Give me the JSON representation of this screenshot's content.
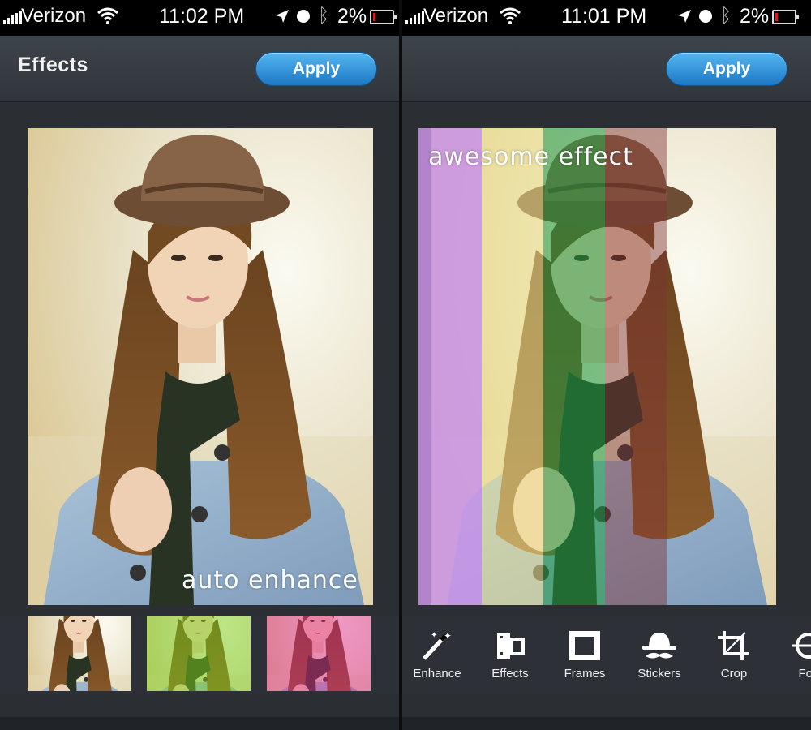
{
  "left_screen": {
    "status": {
      "carrier": "Verizon",
      "time": "11:02 PM",
      "battery": "2%"
    },
    "header": {
      "title": "Effects",
      "apply_label": "Apply"
    },
    "photo_caption": "auto enhance",
    "thumbnails": [
      {
        "name": "original",
        "tint": "none"
      },
      {
        "name": "green",
        "tint": "#7bd21c"
      },
      {
        "name": "magenta",
        "tint": "#e0208c"
      }
    ]
  },
  "right_screen": {
    "status": {
      "carrier": "Verizon",
      "time": "11:01 PM",
      "battery": "2%"
    },
    "header": {
      "apply_label": "Apply"
    },
    "photo_caption": "awesome effect",
    "stripe_colors": [
      "#c993e8",
      "#f1e58f",
      "#1c9b3f",
      "#7e3032"
    ],
    "toolbar": [
      {
        "label": "Enhance",
        "icon": "magic-wand-icon"
      },
      {
        "label": "Effects",
        "icon": "film-roll-icon"
      },
      {
        "label": "Frames",
        "icon": "frame-icon"
      },
      {
        "label": "Stickers",
        "icon": "hat-mustache-icon"
      },
      {
        "label": "Crop",
        "icon": "crop-icon"
      },
      {
        "label": "Foc",
        "icon": "focus-icon"
      }
    ]
  },
  "colors": {
    "apply_button": "#2a8ad6",
    "nav_bg": "#363b41",
    "app_bg": "#2b2f34"
  }
}
